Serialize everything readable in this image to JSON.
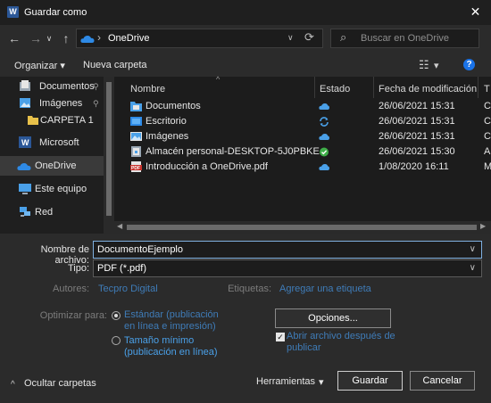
{
  "window": {
    "title": "Guardar como",
    "app_icon": "W",
    "close_glyph": "✕"
  },
  "address": {
    "back_glyph": "←",
    "forward_glyph": "→",
    "recent_glyph": "∨",
    "up_glyph": "↑",
    "sep_glyph": "›",
    "location": "OneDrive",
    "dropdown_glyph": "∨",
    "refresh_glyph": "⟳",
    "search_placeholder": "Buscar en OneDrive",
    "search_glyph": "⌕"
  },
  "toolbar": {
    "organize_label": "Organizar",
    "organize_caret": "▾",
    "new_folder_label": "Nueva carpeta",
    "view_glyph": "☷",
    "view_caret": "▾",
    "help_glyph": "?"
  },
  "navpane": {
    "items": [
      {
        "label": "Documentos",
        "icon": "documents-icon",
        "pinned": true
      },
      {
        "label": "Imágenes",
        "icon": "images-icon",
        "pinned": true
      },
      {
        "label": "CARPETA 1",
        "icon": "folder-icon",
        "pinned": false
      },
      {
        "label": "Microsoft Word",
        "icon": "word-icon",
        "pinned": false
      },
      {
        "label": "OneDrive",
        "icon": "onedrive-icon",
        "pinned": false,
        "selected": true
      },
      {
        "label": "Este equipo",
        "icon": "computer-icon",
        "pinned": false
      },
      {
        "label": "Red",
        "icon": "network-icon",
        "pinned": false
      }
    ],
    "pin_glyph": "📌"
  },
  "filelist": {
    "columns": {
      "name": "Nombre",
      "status": "Estado",
      "modified": "Fecha de modificación",
      "type": "T"
    },
    "sort_glyph": "^",
    "rows": [
      {
        "name": "Documentos",
        "icon": "folder-blue-icon",
        "status": "cloud-icon",
        "date": "26/06/2021 15:31",
        "type": "C"
      },
      {
        "name": "Escritorio",
        "icon": "desktop-folder-icon",
        "status": "sync-icon",
        "date": "26/06/2021 15:31",
        "type": "C"
      },
      {
        "name": "Imágenes",
        "icon": "images-folder-icon",
        "status": "cloud-icon",
        "date": "26/06/2021 15:31",
        "type": "C"
      },
      {
        "name": "Almacén personal-DESKTOP-5J0PBKE",
        "icon": "vault-icon",
        "status": "check-icon",
        "date": "26/06/2021 15:30",
        "type": "A"
      },
      {
        "name": "Introducción a OneDrive.pdf",
        "icon": "pdf-icon",
        "status": "cloud-icon",
        "date": "1/08/2020 16:11",
        "type": "M"
      }
    ]
  },
  "form": {
    "filename_label": "Nombre de archivo:",
    "filename_value": "DocumentoEjemplo",
    "type_label": "Tipo:",
    "type_value": "PDF (*.pdf)",
    "authors_label": "Autores:",
    "authors_value": "Tecpro Digital",
    "tags_label": "Etiquetas:",
    "tags_value": "Agregar una etiqueta",
    "optimize_label": "Optimizar para:",
    "optimize_standard_line1": "Estándar (publicación",
    "optimize_standard_line2": "en línea e impresión)",
    "optimize_min_line1": "Tamaño mínimo",
    "optimize_min_line2": "(publicación en línea)",
    "options_button": "Opciones...",
    "open_after_line1": "Abrir archivo después de",
    "open_after_line2": "publicar",
    "open_after_checked": true,
    "hide_folders_glyph": "^",
    "hide_folders_label": "Ocultar carpetas",
    "tools_label": "Herramientas",
    "tools_caret": "▾",
    "save_button": "Guardar",
    "cancel_button": "Cancelar"
  },
  "colors": {
    "accent": "#4aa0e8",
    "onedrive_blue": "#2e8ae6",
    "pdf_red": "#c8312b",
    "word_blue": "#2b5797",
    "folder_yellow": "#e8c14a",
    "sync_green": "#3fae49"
  }
}
